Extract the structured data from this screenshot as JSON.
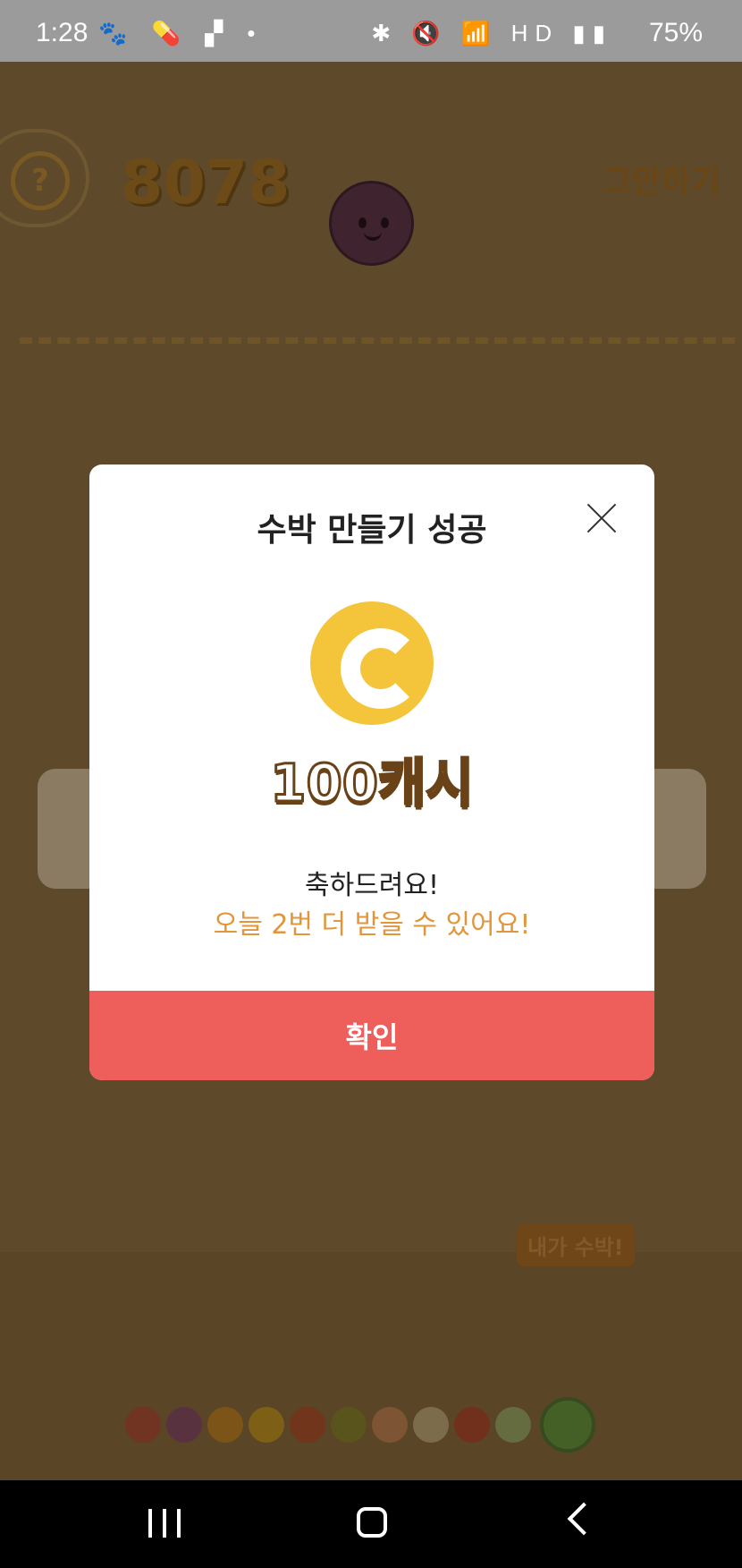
{
  "status_bar": {
    "time": "1:28",
    "left_icons": "🐾 💊 ▞ •",
    "right_icons": "✱ 🔇 📶 HD ▮▮",
    "battery": "75%"
  },
  "game": {
    "help_label": "?",
    "score": "8078",
    "quit_label": "그만하기",
    "badge_label": "내가 수박!"
  },
  "modal": {
    "title": "수박 만들기 성공",
    "reward_text": "100캐시",
    "congrats_text": "축하드려요!",
    "remaining_text": "오늘 2번 더 받을 수 있어요!",
    "confirm_label": "확인"
  },
  "colors": {
    "coin": "#f4c53a",
    "confirm": "#ee5f5b",
    "accent_text": "#e2963a"
  },
  "icons": [
    "close-icon",
    "coin-icon",
    "help-icon",
    "nav-recents-icon",
    "nav-home-icon",
    "nav-back-icon"
  ]
}
